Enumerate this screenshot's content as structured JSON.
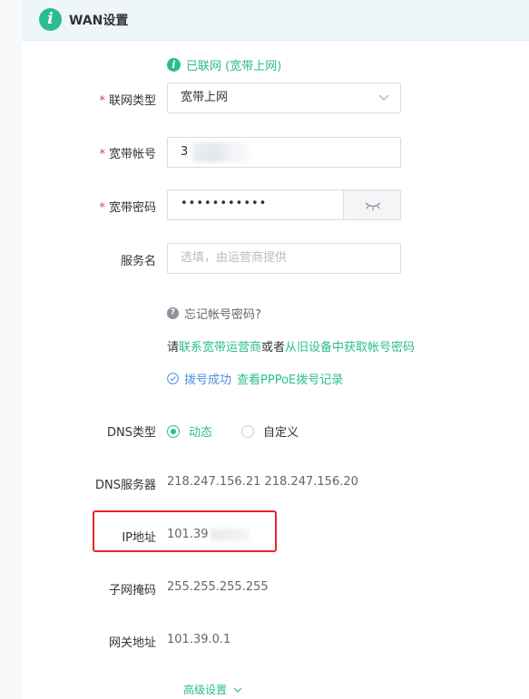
{
  "header": {
    "title": "WAN设置",
    "icon": "info-icon"
  },
  "status": {
    "text": "已联网 (宽带上网)",
    "color": "#2cbc8e"
  },
  "form": {
    "wan_type": {
      "label": "联网类型",
      "required": "*",
      "value": "宽带上网"
    },
    "account": {
      "label": "宽带帐号",
      "required": "*",
      "value": "3"
    },
    "password": {
      "label": "宽带密码",
      "required": "*",
      "value": "•••••••••••"
    },
    "service": {
      "label": "服务名",
      "placeholder": "选填，由运营商提供"
    }
  },
  "help": {
    "forgot": "忘记帐号密码?",
    "contact_prefix": "请",
    "contact_link": "联系宽带运营商",
    "contact_mid": "或者",
    "contact_link2": "从旧设备中获取帐号密码",
    "dial_success": "拨号成功",
    "dial_log": "查看PPPoE拨号记录"
  },
  "dns_type": {
    "label": "DNS类型",
    "options": [
      "动态",
      "自定义"
    ],
    "selected": "动态"
  },
  "dns_server": {
    "label": "DNS服务器",
    "value": "218.247.156.21 218.247.156.20"
  },
  "ip": {
    "label": "IP地址",
    "value": "101.39"
  },
  "mask": {
    "label": "子网掩码",
    "value": "255.255.255.255"
  },
  "gateway": {
    "label": "网关地址",
    "value": "101.39.0.1"
  },
  "advanced": {
    "label": "高级设置"
  },
  "colors": {
    "accent": "#2cbc8e",
    "required": "#e0413a",
    "highlight": "#e6262b",
    "link_blue": "#4a8fe0"
  }
}
